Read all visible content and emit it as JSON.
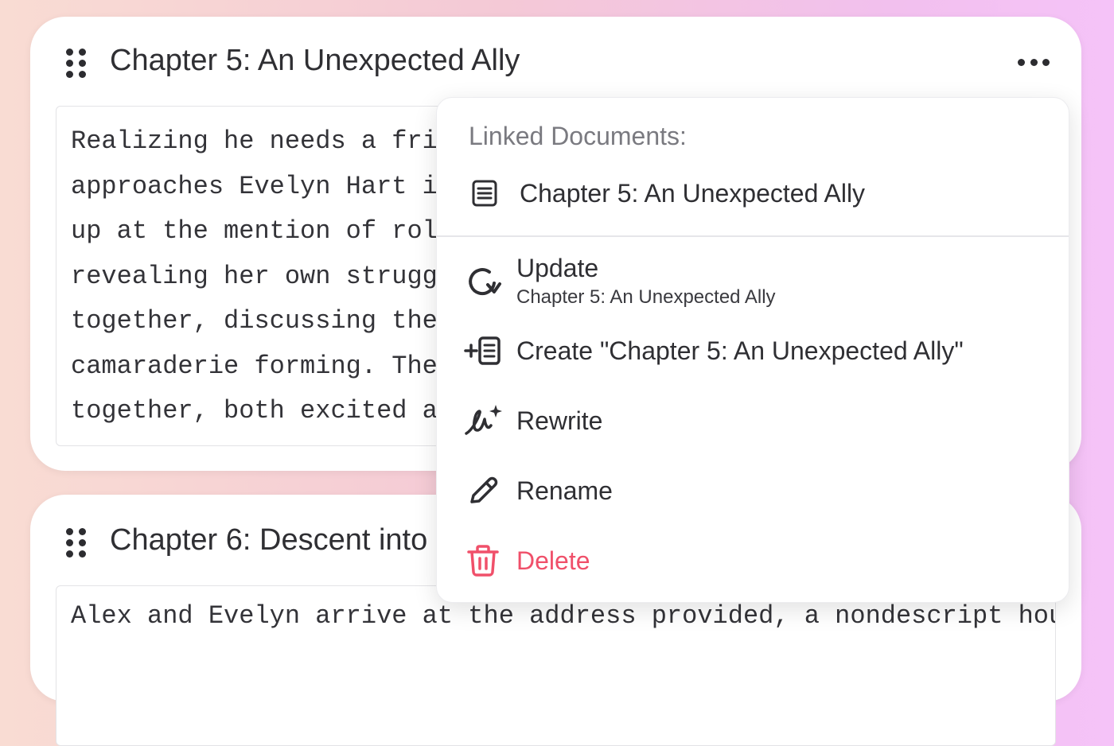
{
  "cards": [
    {
      "title": "Chapter 5: An Unexpected Ally",
      "summary_lines": [
        "Realizing he needs a friend to",
        "approaches Evelyn Hart in a",
        "up at the mention of role-pla",
        "revealing her own struggles",
        "together, discussing their fa",
        "camaraderie forming. They",
        "together, both excited and s"
      ]
    },
    {
      "title": "Chapter 6: Descent into",
      "summary_lines": [
        "Alex and Evelyn arrive at the address provided, a nondescript house with"
      ]
    }
  ],
  "menu": {
    "heading": "Linked Documents:",
    "linked_doc": {
      "label": "Chapter 5: An Unexpected Ally",
      "icon": "document-icon"
    },
    "items": [
      {
        "id": "update",
        "label": "Update",
        "sublabel": "Chapter 5: An Unexpected Ally",
        "icon": "refresh-icon"
      },
      {
        "id": "create",
        "label": "Create \"Chapter 5: An Unexpected Ally\"",
        "icon": "add-document-icon"
      },
      {
        "id": "rewrite",
        "label": "Rewrite",
        "icon": "ai-rewrite-icon"
      },
      {
        "id": "rename",
        "label": "Rename",
        "icon": "pencil-icon"
      },
      {
        "id": "delete",
        "label": "Delete",
        "icon": "trash-icon"
      }
    ]
  },
  "colors": {
    "danger": "#f0506a",
    "text": "#2f2f33",
    "muted": "#7a7a80"
  }
}
